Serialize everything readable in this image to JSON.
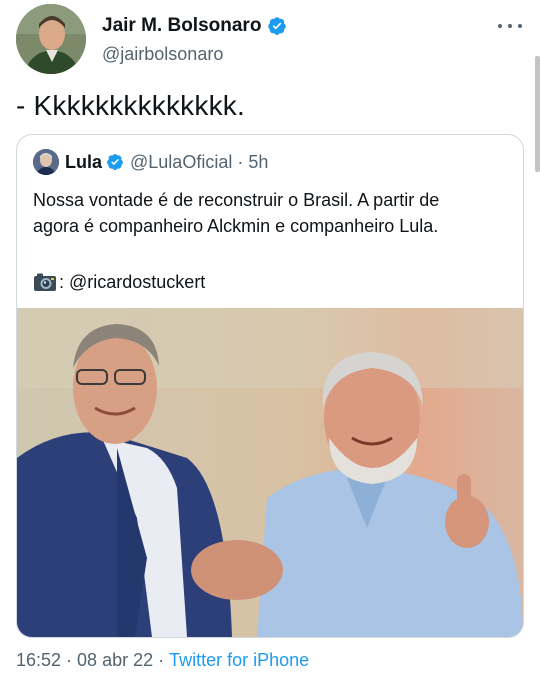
{
  "author": {
    "name": "Jair M. Bolsonaro",
    "handle": "@jairbolsonaro",
    "verified": true,
    "avatar_icon": "user-avatar"
  },
  "tweet_text": "- Kkkkkkkkkkkkkk.",
  "quoted_tweet": {
    "name": "Lula",
    "handle": "@LulaOficial",
    "separator": "·",
    "time_ago": "5h",
    "verified": true,
    "text_line_1": "Nossa vontade é de reconstruir o Brasil. A partir de",
    "text_line_2": "agora é companheiro Alckmin e companheiro Lula.",
    "photo_credit": ": @ricardostuckert",
    "credit_icon": "camera-icon"
  },
  "footer": {
    "time": "16:52",
    "sep1": "·",
    "date": "08 abr 22",
    "sep2": "·",
    "source": "Twitter for iPhone"
  },
  "colors": {
    "accent": "#1d9bf0",
    "secondary_text": "#536471",
    "border": "#cfd9de"
  }
}
